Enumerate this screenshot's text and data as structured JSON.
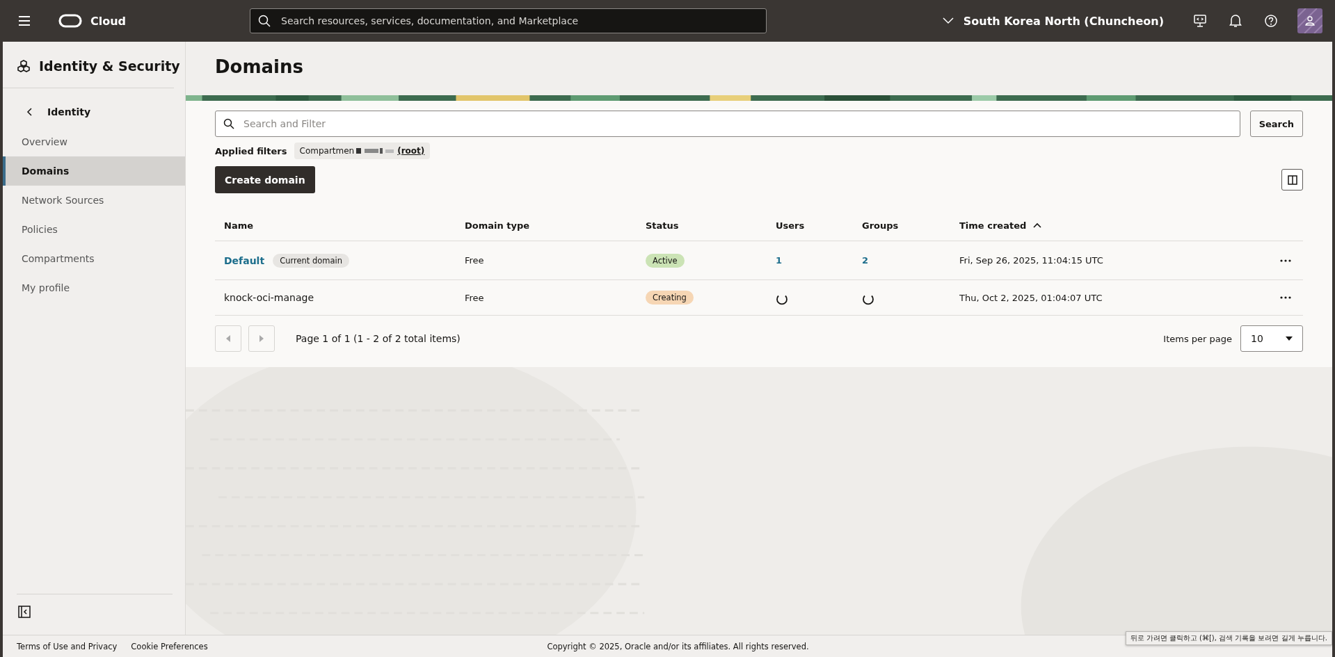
{
  "topbar": {
    "brand": "Cloud",
    "search_placeholder": "Search resources, services, documentation, and Marketplace",
    "region": "South Korea North (Chuncheon)"
  },
  "sidebar": {
    "title": "Identity & Security",
    "back_label": "Identity",
    "items": [
      {
        "label": "Overview",
        "selected": false
      },
      {
        "label": "Domains",
        "selected": true
      },
      {
        "label": "Network Sources",
        "selected": false
      },
      {
        "label": "Policies",
        "selected": false
      },
      {
        "label": "Compartments",
        "selected": false
      },
      {
        "label": "My profile",
        "selected": false
      }
    ]
  },
  "page": {
    "title": "Domains",
    "filter_placeholder": "Search and Filter",
    "search_button": "Search",
    "applied_filters_label": "Applied filters",
    "filter_chip": {
      "prefix": "Compartmen",
      "suffix": "(root)"
    },
    "create_button": "Create domain"
  },
  "table": {
    "columns": [
      {
        "label": "Name"
      },
      {
        "label": "Domain type"
      },
      {
        "label": "Status"
      },
      {
        "label": "Users"
      },
      {
        "label": "Groups"
      },
      {
        "label": "Time created",
        "sorted": true
      }
    ],
    "rows": [
      {
        "name": "Default",
        "name_link": true,
        "badge": "Current domain",
        "type": "Free",
        "status": {
          "label": "Active",
          "kind": "success"
        },
        "users": {
          "kind": "link",
          "text": "1"
        },
        "groups": {
          "kind": "link",
          "text": "2"
        },
        "time": "Fri, Sep 26, 2025, 11:04:15 UTC"
      },
      {
        "name": "knock-oci-manage",
        "name_link": false,
        "type": "Free",
        "status": {
          "label": "Creating",
          "kind": "pending"
        },
        "users": {
          "kind": "spinner"
        },
        "groups": {
          "kind": "spinner"
        },
        "time": "Thu, Oct 2, 2025, 01:04:07 UTC"
      }
    ]
  },
  "pagination": {
    "summary": "Page 1 of 1 (1 - 2 of 2 total items)",
    "per_page_label": "Items per page",
    "per_page": "10"
  },
  "footer": {
    "links": [
      "Terms of Use and Privacy",
      "Cookie Preferences"
    ],
    "copyright": "Copyright © 2025, Oracle and/or its affiliates. All rights reserved.",
    "tooltip": "뒤로 가려면 클릭하고 (⌘[), 검색 기록을 보려면 길게 누릅니다."
  }
}
